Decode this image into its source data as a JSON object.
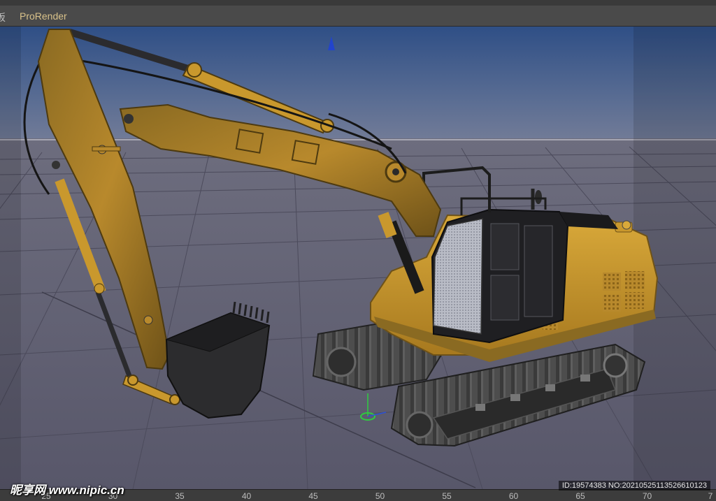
{
  "menubar": {
    "cut_label": "板",
    "prorender_label": "ProRender"
  },
  "timeline": {
    "ticks": [
      "25",
      "30",
      "35",
      "40",
      "45",
      "50",
      "55",
      "60",
      "65",
      "70",
      "7"
    ]
  },
  "watermark": {
    "site": "昵享网 www.nipic.cn",
    "id_text": "ID:19574383 NO:20210525113526610123"
  },
  "colors": {
    "sky_top": "#2f4f86",
    "floor": "#626174",
    "machine_yellow": "#c9982d",
    "accent": "#d9c28a"
  }
}
